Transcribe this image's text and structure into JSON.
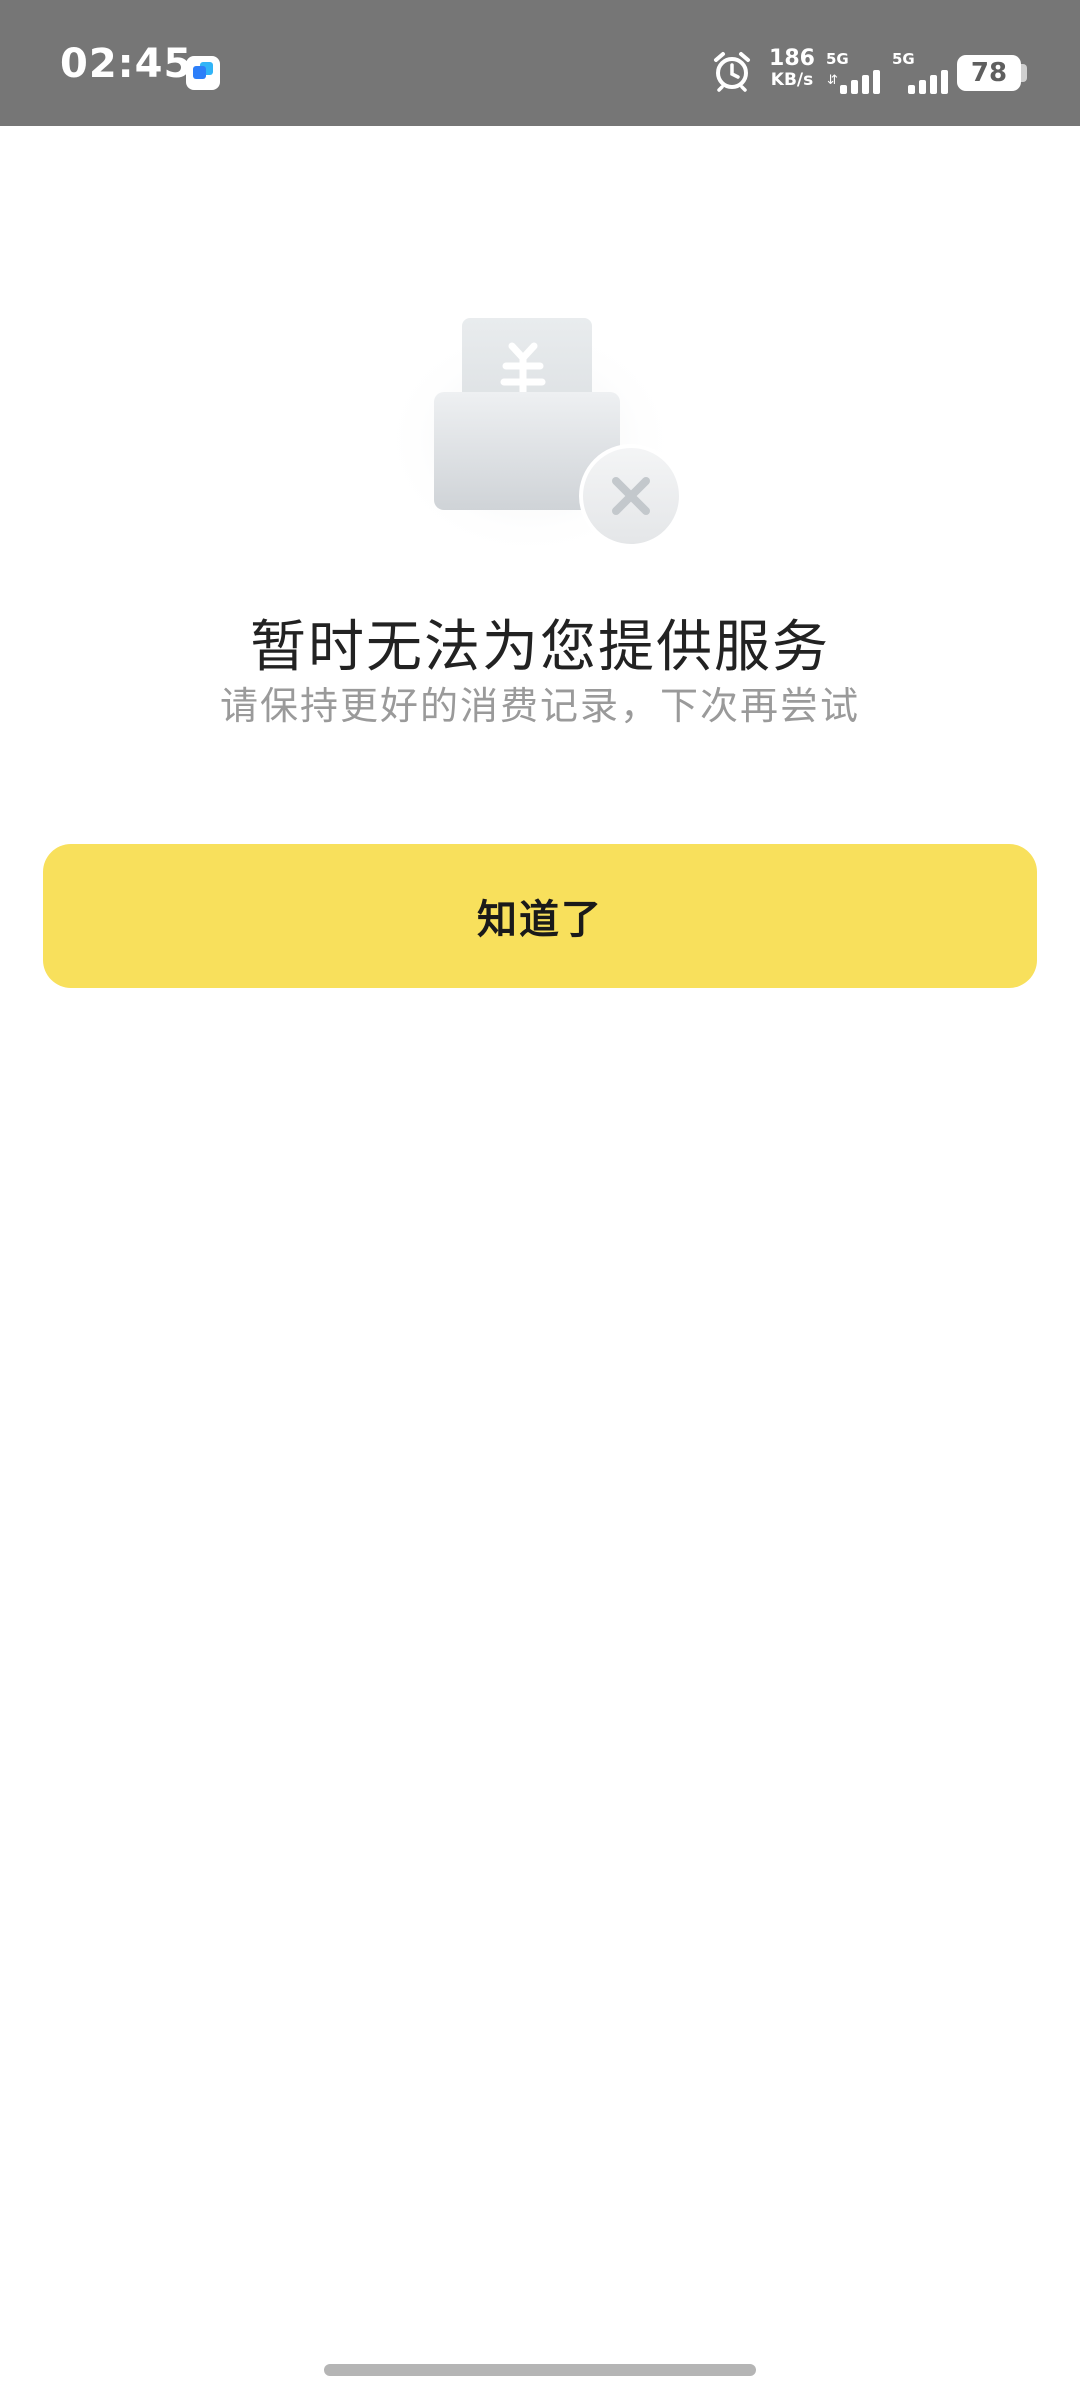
{
  "status_bar": {
    "time": "02:45",
    "net_speed_value": "186",
    "net_speed_unit": "KB/s",
    "sim1_tag": "5G",
    "sim2_tag": "5G",
    "battery_level": "78",
    "icons": [
      "app-notification-icon",
      "alarm-icon",
      "signal-icon",
      "battery-icon"
    ],
    "background_color": "#767676"
  },
  "illustration": {
    "icon": "empty-wallet-error-icon",
    "symbol": "currency-yen"
  },
  "message": {
    "title": "暂时无法为您提供服务",
    "subtitle": "请保持更好的消费记录，下次再尝试"
  },
  "action": {
    "confirm_label": "知道了",
    "button_color": "#f8e05c"
  }
}
